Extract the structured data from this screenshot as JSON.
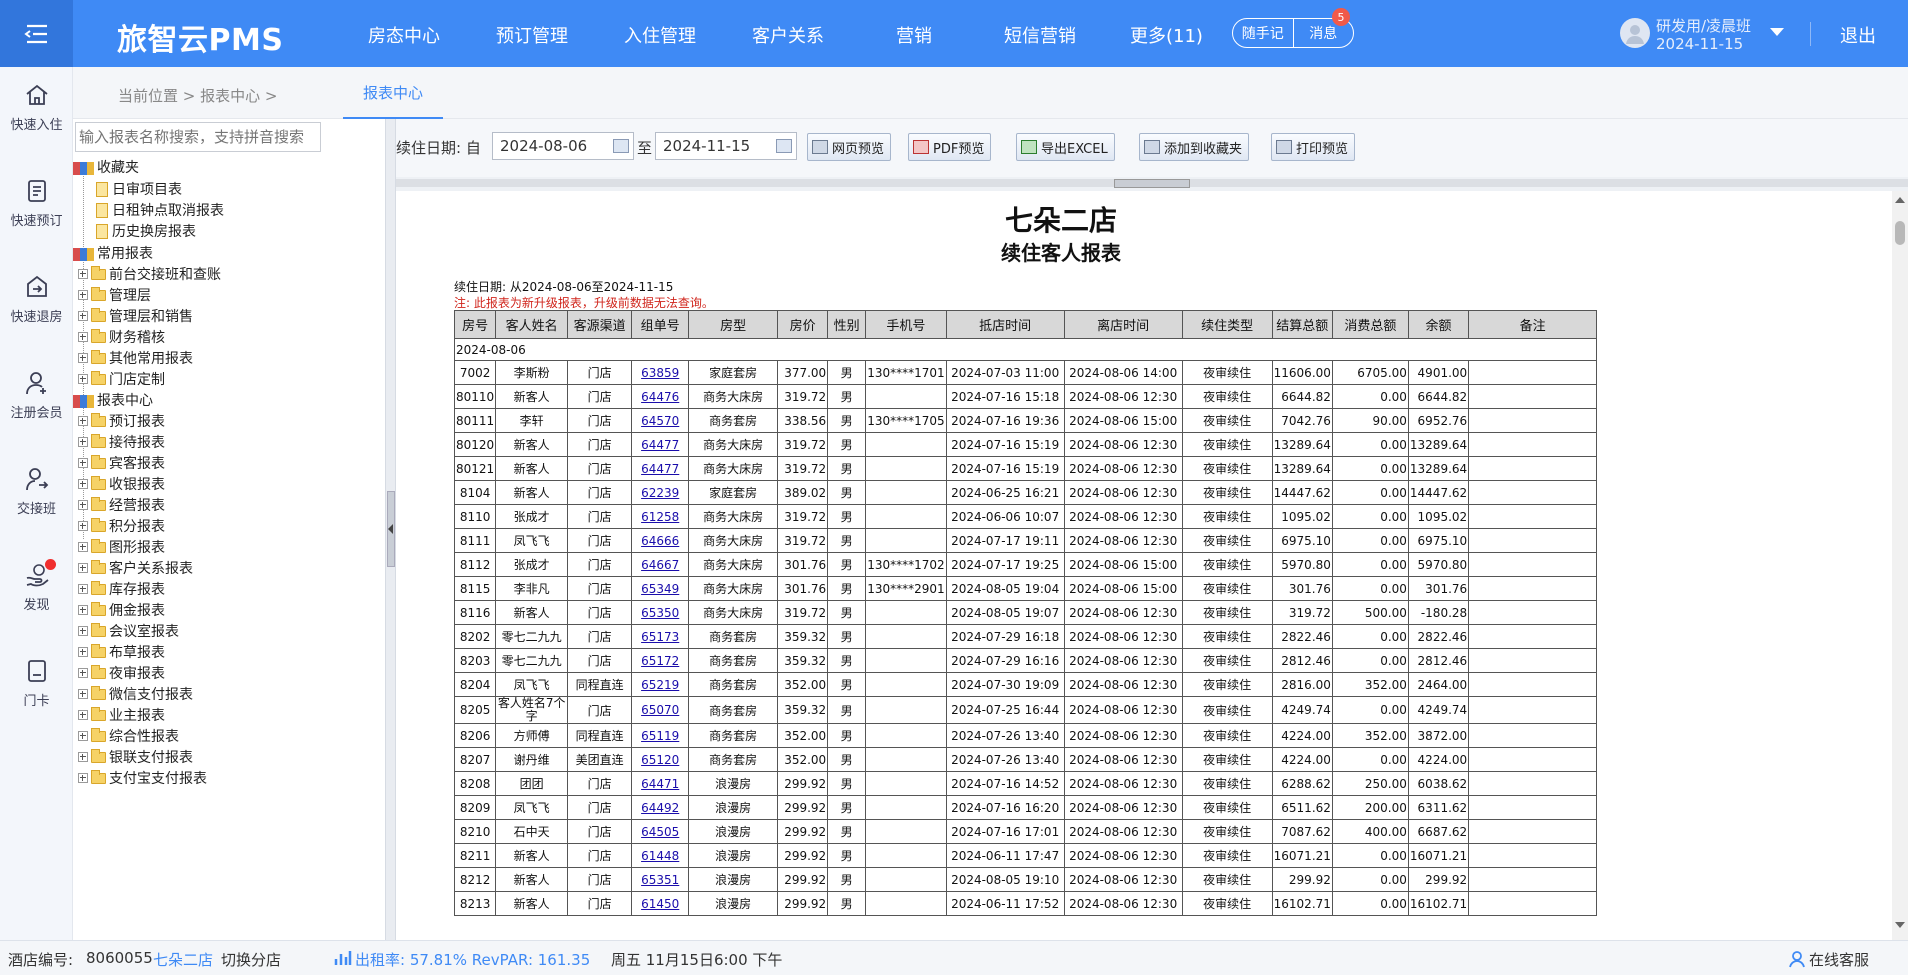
{
  "header": {
    "brand": "旅智云PMS",
    "nav": [
      "房态中心",
      "预订管理",
      "入住管理",
      "客户关系",
      "营销",
      "短信营销"
    ],
    "more": "更多(11)",
    "memo": "随手记",
    "messages": "消息",
    "message_badge": "5",
    "user_name": "研发用/凌晨班",
    "user_date": "2024-11-15",
    "logout": "退出"
  },
  "sidebar": {
    "items": [
      "快速入住",
      "快速预订",
      "快速退房",
      "注册会员",
      "交接班",
      "发现",
      "门卡"
    ]
  },
  "breadcrumb": {
    "text": "当前位置 > 报表中心 >",
    "tab": "报表中心"
  },
  "tree": {
    "search_placeholder": "输入报表名称搜索，支持拼音搜索",
    "favorites": "收藏夹",
    "favorite_items": [
      "日审项目表",
      "日租钟点取消报表",
      "历史换房报表"
    ],
    "common": "常用报表",
    "common_items": [
      "前台交接班和查账",
      "管理层",
      "管理层和销售",
      "财务稽核",
      "其他常用报表",
      "门店定制"
    ],
    "center": "报表中心",
    "center_items": [
      "预订报表",
      "接待报表",
      "宾客报表",
      "收银报表",
      "经营报表",
      "积分报表",
      "图形报表",
      "客户关系报表",
      "库存报表",
      "佣金报表",
      "会议室报表",
      "布草报表",
      "夜审报表",
      "微信支付报表",
      "业主报表",
      "综合性报表",
      "银联支付报表",
      "支付宝支付报表"
    ]
  },
  "toolbar": {
    "date_label": "续住日期: 自",
    "date_from": "2024-08-06",
    "to_label": "至",
    "date_to": "2024-11-15",
    "buttons": [
      "网页预览",
      "PDF预览",
      "导出EXCEL",
      "添加到收藏夹",
      "打印预览"
    ]
  },
  "report": {
    "store": "七朵二店",
    "title": "续住客人报表",
    "range": "续住日期: 从2024-08-06至2024-11-15",
    "note": "注: 此报表为新升级报表，升级前数据无法查询。",
    "headers": [
      "房号",
      "客人姓名",
      "客源渠道",
      "组单号",
      "房型",
      "房价",
      "性别",
      "手机号",
      "抵店时间",
      "离店时间",
      "续住类型",
      "结算总额",
      "消费总额",
      "余额",
      "备注"
    ],
    "group": "2024-08-06",
    "rows": [
      [
        "7002",
        "李斯粉",
        "门店",
        "63859",
        "家庭套房",
        "377.00",
        "男",
        "130****1701",
        "2024-07-03 11:00",
        "2024-08-06 14:00",
        "夜审续住",
        "11606.00",
        "6705.00",
        "4901.00",
        ""
      ],
      [
        "80110",
        "新客人",
        "门店",
        "64476",
        "商务大床房",
        "319.72",
        "男",
        "",
        "2024-07-16 15:18",
        "2024-08-06 12:30",
        "夜审续住",
        "6644.82",
        "0.00",
        "6644.82",
        ""
      ],
      [
        "80111",
        "李轩",
        "门店",
        "64570",
        "商务套房",
        "338.56",
        "男",
        "130****1705",
        "2024-07-16 19:36",
        "2024-08-06 15:00",
        "夜审续住",
        "7042.76",
        "90.00",
        "6952.76",
        ""
      ],
      [
        "80120",
        "新客人",
        "门店",
        "64477",
        "商务大床房",
        "319.72",
        "男",
        "",
        "2024-07-16 15:19",
        "2024-08-06 12:30",
        "夜审续住",
        "13289.64",
        "0.00",
        "13289.64",
        ""
      ],
      [
        "80121",
        "新客人",
        "门店",
        "64477",
        "商务大床房",
        "319.72",
        "男",
        "",
        "2024-07-16 15:19",
        "2024-08-06 12:30",
        "夜审续住",
        "13289.64",
        "0.00",
        "13289.64",
        ""
      ],
      [
        "8104",
        "新客人",
        "门店",
        "62239",
        "家庭套房",
        "389.02",
        "男",
        "",
        "2024-06-25 16:21",
        "2024-08-06 12:30",
        "夜审续住",
        "14447.62",
        "0.00",
        "14447.62",
        ""
      ],
      [
        "8110",
        "张成才",
        "门店",
        "61258",
        "商务大床房",
        "319.72",
        "男",
        "",
        "2024-06-06 10:07",
        "2024-08-06 12:30",
        "夜审续住",
        "1095.02",
        "0.00",
        "1095.02",
        ""
      ],
      [
        "8111",
        "凤飞飞",
        "门店",
        "64666",
        "商务大床房",
        "319.72",
        "男",
        "",
        "2024-07-17 19:11",
        "2024-08-06 12:30",
        "夜审续住",
        "6975.10",
        "0.00",
        "6975.10",
        ""
      ],
      [
        "8112",
        "张成才",
        "门店",
        "64667",
        "商务大床房",
        "301.76",
        "男",
        "130****1702",
        "2024-07-17 19:25",
        "2024-08-06 15:00",
        "夜审续住",
        "5970.80",
        "0.00",
        "5970.80",
        ""
      ],
      [
        "8115",
        "李非凡",
        "门店",
        "65349",
        "商务大床房",
        "301.76",
        "男",
        "130****2901",
        "2024-08-05 19:04",
        "2024-08-06 15:00",
        "夜审续住",
        "301.76",
        "0.00",
        "301.76",
        ""
      ],
      [
        "8116",
        "新客人",
        "门店",
        "65350",
        "商务大床房",
        "319.72",
        "男",
        "",
        "2024-08-05 19:07",
        "2024-08-06 12:30",
        "夜审续住",
        "319.72",
        "500.00",
        "-180.28",
        ""
      ],
      [
        "8202",
        "零七二九九",
        "门店",
        "65173",
        "商务套房",
        "359.32",
        "男",
        "",
        "2024-07-29 16:18",
        "2024-08-06 12:30",
        "夜审续住",
        "2822.46",
        "0.00",
        "2822.46",
        ""
      ],
      [
        "8203",
        "零七二九九",
        "门店",
        "65172",
        "商务套房",
        "359.32",
        "男",
        "",
        "2024-07-29 16:16",
        "2024-08-06 12:30",
        "夜审续住",
        "2812.46",
        "0.00",
        "2812.46",
        ""
      ],
      [
        "8204",
        "凤飞飞",
        "同程直连",
        "65219",
        "商务套房",
        "352.00",
        "男",
        "",
        "2024-07-30 19:09",
        "2024-08-06 12:30",
        "夜审续住",
        "2816.00",
        "352.00",
        "2464.00",
        ""
      ],
      [
        "8205",
        "客人姓名7个字",
        "门店",
        "65070",
        "商务套房",
        "359.32",
        "男",
        "",
        "2024-07-25 16:44",
        "2024-08-06 12:30",
        "夜审续住",
        "4249.74",
        "0.00",
        "4249.74",
        ""
      ],
      [
        "8206",
        "方师傅",
        "同程直连",
        "65119",
        "商务套房",
        "352.00",
        "男",
        "",
        "2024-07-26 13:40",
        "2024-08-06 12:30",
        "夜审续住",
        "4224.00",
        "352.00",
        "3872.00",
        ""
      ],
      [
        "8207",
        "谢丹维",
        "美团直连",
        "65120",
        "商务套房",
        "352.00",
        "男",
        "",
        "2024-07-26 13:40",
        "2024-08-06 12:30",
        "夜审续住",
        "4224.00",
        "0.00",
        "4224.00",
        ""
      ],
      [
        "8208",
        "团团",
        "门店",
        "64471",
        "浪漫房",
        "299.92",
        "男",
        "",
        "2024-07-16 14:52",
        "2024-08-06 12:30",
        "夜审续住",
        "6288.62",
        "250.00",
        "6038.62",
        ""
      ],
      [
        "8209",
        "凤飞飞",
        "门店",
        "64492",
        "浪漫房",
        "299.92",
        "男",
        "",
        "2024-07-16 16:20",
        "2024-08-06 12:30",
        "夜审续住",
        "6511.62",
        "200.00",
        "6311.62",
        ""
      ],
      [
        "8210",
        "石中天",
        "门店",
        "64505",
        "浪漫房",
        "299.92",
        "男",
        "",
        "2024-07-16 17:01",
        "2024-08-06 12:30",
        "夜审续住",
        "7087.62",
        "400.00",
        "6687.62",
        ""
      ],
      [
        "8211",
        "新客人",
        "门店",
        "61448",
        "浪漫房",
        "299.92",
        "男",
        "",
        "2024-06-11 17:47",
        "2024-08-06 12:30",
        "夜审续住",
        "16071.21",
        "0.00",
        "16071.21",
        ""
      ],
      [
        "8212",
        "新客人",
        "门店",
        "65351",
        "浪漫房",
        "299.92",
        "男",
        "",
        "2024-08-05 19:10",
        "2024-08-06 12:30",
        "夜审续住",
        "299.92",
        "0.00",
        "299.92",
        ""
      ],
      [
        "8213",
        "新客人",
        "门店",
        "61450",
        "浪漫房",
        "299.92",
        "男",
        "",
        "2024-06-11 17:52",
        "2024-08-06 12:30",
        "夜审续住",
        "16102.71",
        "0.00",
        "16102.71",
        ""
      ]
    ]
  },
  "status": {
    "hotel_label": "酒店编号:",
    "hotel_code": "8060055",
    "store": "七朵二店",
    "switch": "切换分店",
    "occupancy": "出租率: 57.81% RevPAR: 161.35",
    "datetime": "周五 11月15日6:00 下午",
    "service": "在线客服"
  },
  "colors": {
    "topbar": "#3f8af5",
    "accent": "#3f8af5",
    "warning": "#d0251c",
    "link": "#1a0dab"
  }
}
